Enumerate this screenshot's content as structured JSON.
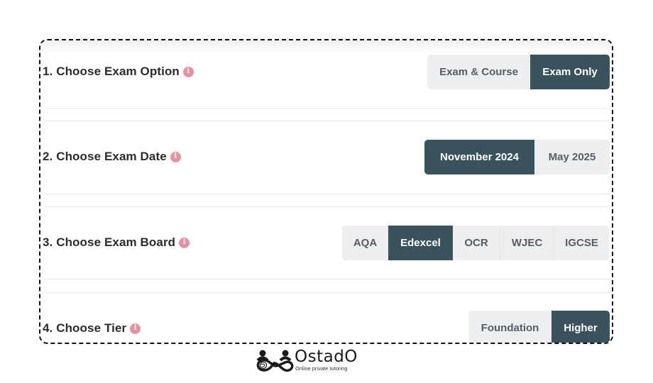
{
  "sections": [
    {
      "label": "1. Choose Exam Option",
      "info_icon": "info-icon",
      "options": [
        {
          "label": "Exam & Course",
          "selected": false
        },
        {
          "label": "Exam Only",
          "selected": true
        }
      ]
    },
    {
      "label": "2. Choose Exam Date",
      "info_icon": "info-icon",
      "options": [
        {
          "label": "November 2024",
          "selected": true
        },
        {
          "label": "May 2025",
          "selected": false
        }
      ]
    },
    {
      "label": "3. Choose Exam Board",
      "info_icon": "info-icon",
      "options": [
        {
          "label": "AQA",
          "selected": false
        },
        {
          "label": "Edexcel",
          "selected": true
        },
        {
          "label": "OCR",
          "selected": false
        },
        {
          "label": "WJEC",
          "selected": false
        },
        {
          "label": "IGCSE",
          "selected": false
        }
      ]
    },
    {
      "label": "4. Choose Tier",
      "info_icon": "info-icon",
      "options": [
        {
          "label": "Foundation",
          "selected": false
        },
        {
          "label": "Higher",
          "selected": true
        }
      ]
    }
  ],
  "info_glyph": "i",
  "colors": {
    "selected_bg": "#3a525c",
    "unselected_bg": "#eceef0",
    "info_icon": "#e6929e"
  },
  "logo": {
    "name": "OstadO",
    "tagline": "Online private tutoring"
  }
}
